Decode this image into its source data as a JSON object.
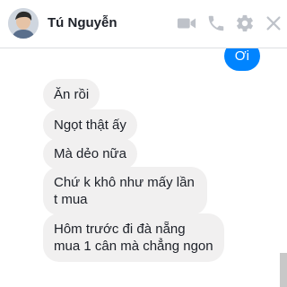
{
  "header": {
    "contact_name": "Tú Nguyễn",
    "icons": [
      "video-call-icon",
      "phone-call-icon",
      "settings-gear-icon",
      "close-icon"
    ]
  },
  "messages": [
    {
      "direction": "outgoing",
      "text": "Ơi"
    },
    {
      "direction": "incoming",
      "text": "Ăn rồi"
    },
    {
      "direction": "incoming",
      "text": "Ngọt thật ấy"
    },
    {
      "direction": "incoming",
      "text": "Mà dẻo nữa"
    },
    {
      "direction": "incoming",
      "text": "Chứ k khô như mấy lần t mua"
    },
    {
      "direction": "incoming",
      "text": "Hôm trước đi đà nẵng mua 1 cân mà chẳng ngon"
    }
  ],
  "colors": {
    "accent": "#0084ff",
    "incoming_bubble": "#f1f0f0",
    "header_icons": "#bec2c9"
  }
}
